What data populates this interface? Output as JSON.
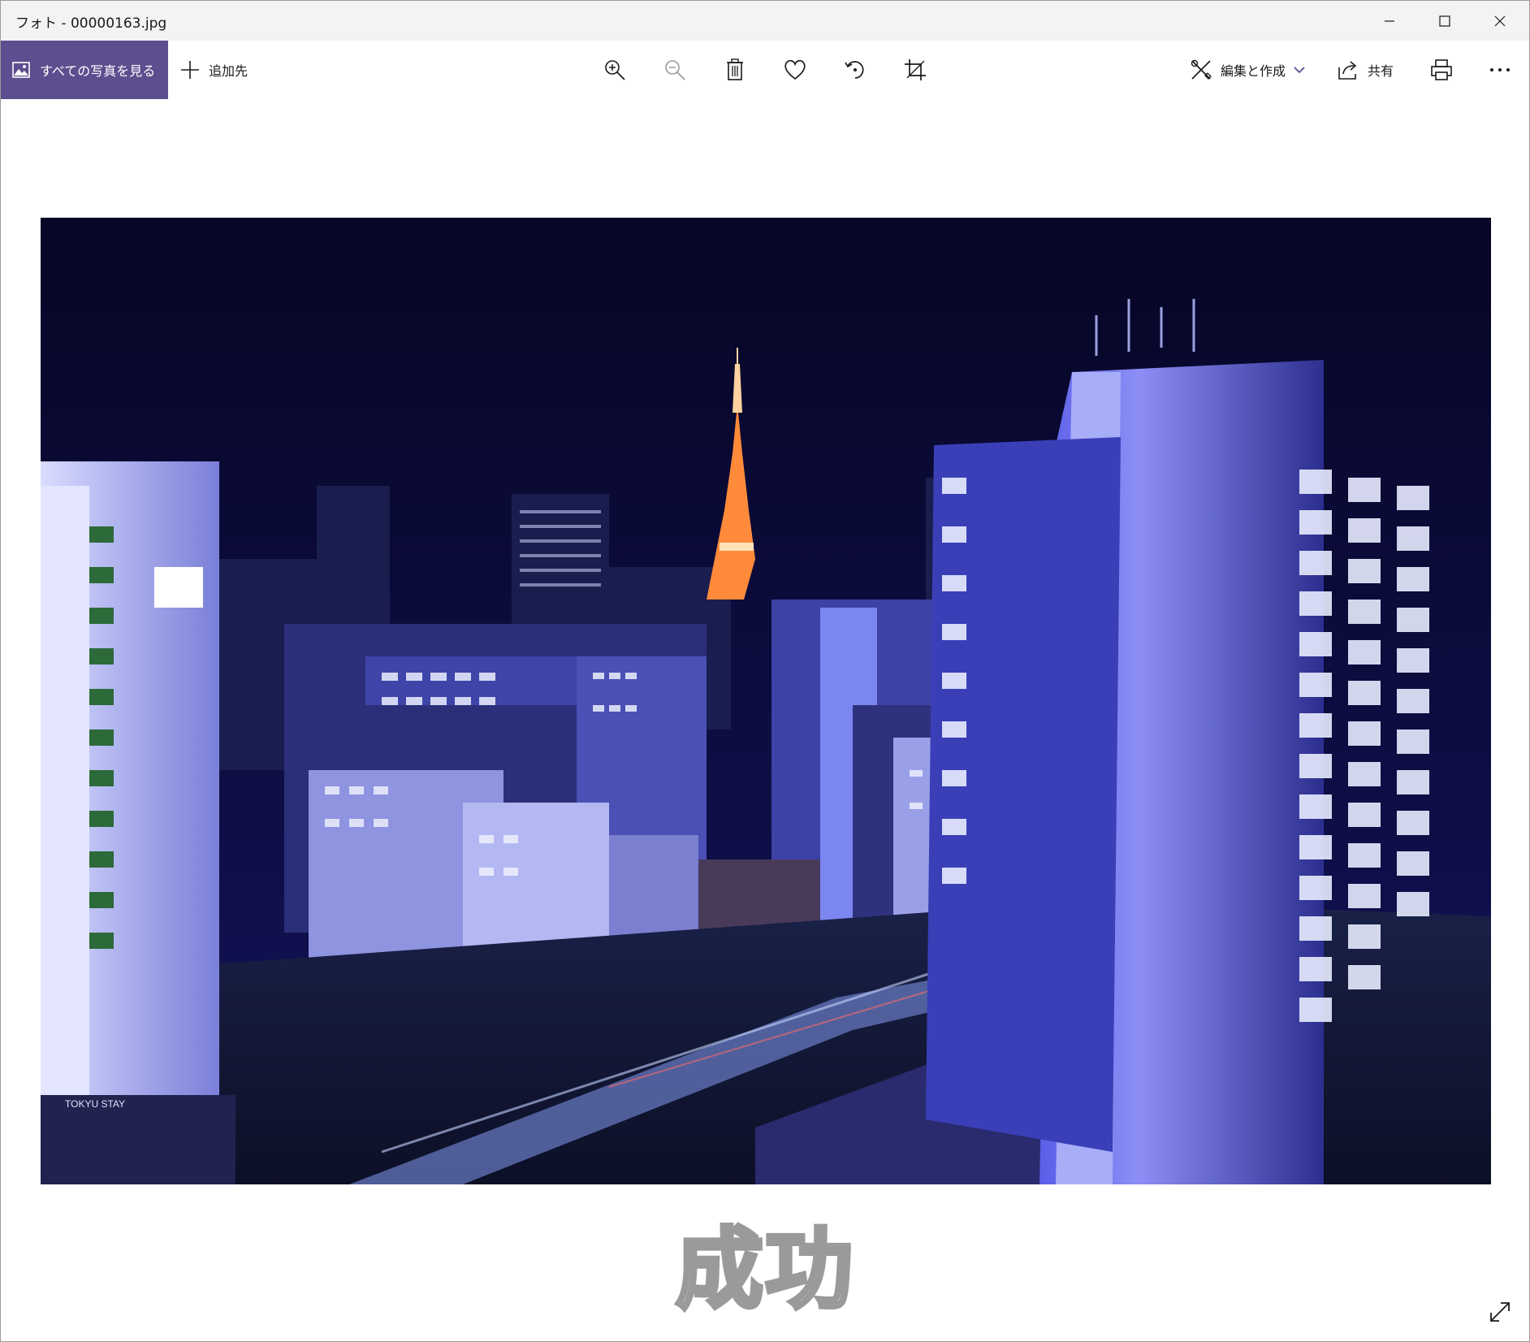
{
  "window": {
    "title": "フォト - 00000163.jpg"
  },
  "toolbar": {
    "all_photos_label": "すべての写真を見る",
    "add_to_label": "追加先",
    "edit_create_label": "編集と作成",
    "share_label": "共有",
    "tools": [
      "zoom-in",
      "zoom-out",
      "delete",
      "favorite",
      "rotate",
      "crop"
    ]
  },
  "photo": {
    "sign_text": "TOKYU STAY"
  },
  "caption": "成功",
  "colors": {
    "accent": "#5d4e8f",
    "sky": "#0b0b3a",
    "tower": "#ff8a3a"
  }
}
